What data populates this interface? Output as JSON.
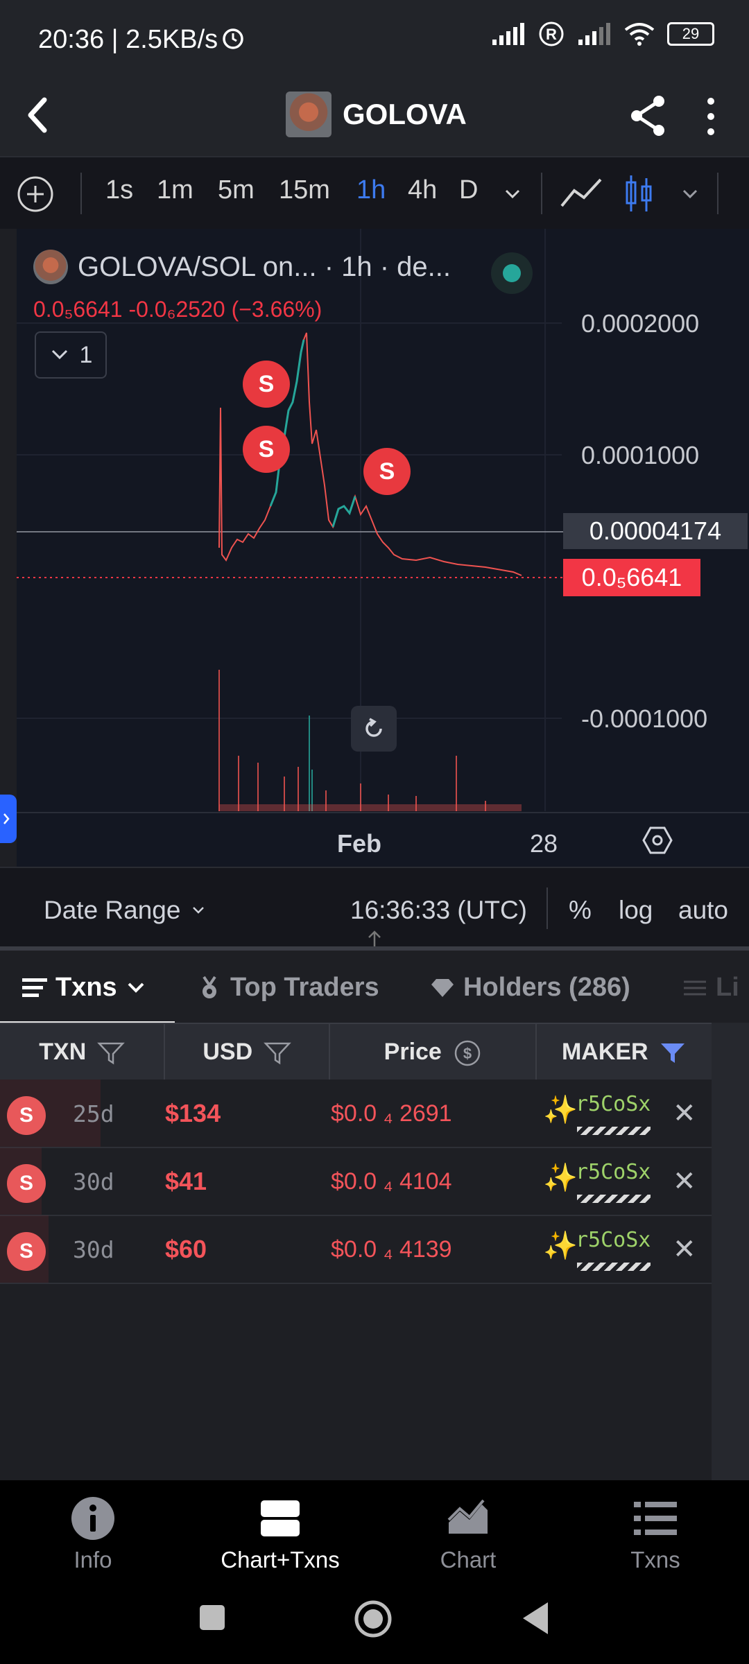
{
  "status_bar": {
    "time": "20:36 | 2.5KB/s",
    "battery": "29"
  },
  "header": {
    "title": "GOLOVA"
  },
  "timeframes": {
    "items": [
      "1s",
      "1m",
      "5m",
      "15m",
      "1h",
      "4h",
      "D"
    ],
    "active": "1h"
  },
  "chart": {
    "legend": "GOLOVA/SOL on... · 1h · de...",
    "price_line": "0.0₅6641 -0.0₆2520 (−3.66%)",
    "collapse_label": "1",
    "y_labels": [
      "0.0002000",
      "0.0001000",
      "-0.0001000"
    ],
    "crosshair_value": "0.00004174",
    "last_price": "0.0₅6641",
    "x_labels": [
      "Feb",
      "28"
    ],
    "date_range_label": "Date Range",
    "time_utc": "16:36:33 (UTC)",
    "options": [
      "%",
      "log",
      "auto"
    ],
    "markers": [
      "S",
      "S",
      "S"
    ],
    "colors": {
      "up": "#26a69a",
      "down": "#ef5350",
      "badge": "#e8393f"
    }
  },
  "tabs": [
    {
      "label": "Txns"
    },
    {
      "label": "Top Traders"
    },
    {
      "label": "Holders (286)"
    },
    {
      "label": "Li"
    }
  ],
  "table": {
    "columns": [
      "TXN",
      "USD",
      "Price",
      "MAKER"
    ],
    "rows": [
      {
        "type": "S",
        "age": "25d",
        "usd": "$134",
        "price": "$0.0 ₄ 2691",
        "maker": "r5CoSx"
      },
      {
        "type": "S",
        "age": "30d",
        "usd": "$41",
        "price": "$0.0 ₄ 4104",
        "maker": "r5CoSx"
      },
      {
        "type": "S",
        "age": "30d",
        "usd": "$60",
        "price": "$0.0 ₄ 4139",
        "maker": "r5CoSx"
      }
    ]
  },
  "bottom_nav": [
    {
      "label": "Info",
      "icon": "info-icon"
    },
    {
      "label": "Chart+Txns",
      "icon": "chart-txns-icon"
    },
    {
      "label": "Chart",
      "icon": "area-chart-icon"
    },
    {
      "label": "Txns",
      "icon": "list-icon"
    }
  ]
}
